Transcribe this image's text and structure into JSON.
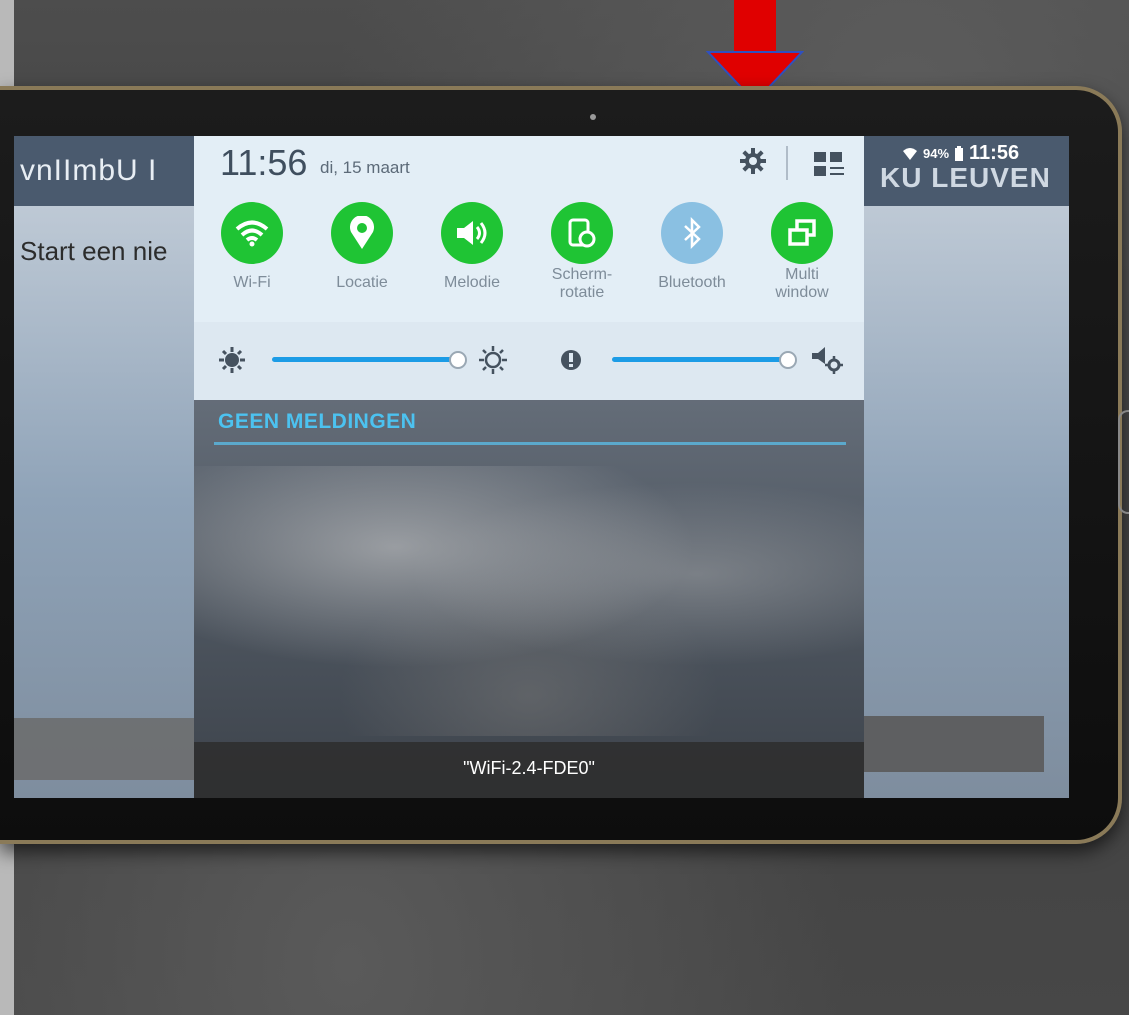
{
  "left_app": {
    "title": "vnIImbU I",
    "text": "Start een nie"
  },
  "right_app": {
    "logo": "KU LEUVEN"
  },
  "status_bar": {
    "battery": "94%",
    "time": "11:56",
    "icons": [
      "wifi-icon",
      "battery-icon"
    ]
  },
  "quick_settings": {
    "time": "11:56",
    "date": "di, 15 maart",
    "header_icons": [
      "settings-gear-icon",
      "edit-grid-icon"
    ],
    "tiles": [
      {
        "label": "Wi-Fi",
        "icon": "wifi-icon",
        "state": "on"
      },
      {
        "label": "Locatie",
        "icon": "location-pin-icon",
        "state": "on"
      },
      {
        "label": "Melodie",
        "icon": "speaker-icon",
        "state": "on"
      },
      {
        "label": "Scherm-\nrotatie",
        "icon": "screen-rotation-icon",
        "state": "on"
      },
      {
        "label": "Bluetooth",
        "icon": "bluetooth-icon",
        "state": "off"
      },
      {
        "label": "Multi\nwindow",
        "icon": "multi-window-icon",
        "state": "on"
      }
    ],
    "brightness_level": 0.95,
    "volume_level": 0.95
  },
  "notifications": {
    "header": "GEEN MELDINGEN"
  },
  "toast": {
    "text": "\"WiFi-2.4-FDE0\""
  },
  "colors": {
    "tile_on": "#1fc434",
    "tile_off": "#8ac0e2",
    "accent": "#4cc2f0",
    "arrow": "#e00000"
  }
}
